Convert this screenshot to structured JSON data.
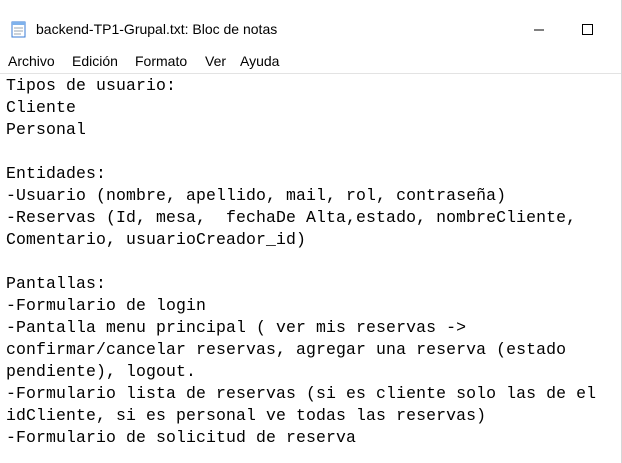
{
  "window": {
    "title": "backend-TP1-Grupal.txt: Bloc de notas",
    "icon": "notepad-icon"
  },
  "menu": [
    {
      "label": "Archivo"
    },
    {
      "label": "Edición"
    },
    {
      "label": "Formato"
    },
    {
      "label": "Ver"
    },
    {
      "label": "Ayuda"
    }
  ],
  "editor": {
    "lines": [
      "Tipos de usuario:",
      "Cliente",
      "Personal",
      "",
      "Entidades:",
      "-Usuario (nombre, apellido, mail, rol, contraseña)",
      "-Reservas (Id, mesa,  fechaDe Alta,estado, nombreCliente,",
      "Comentario, usuarioCreador_id)",
      "",
      "Pantallas:",
      "-Formulario de login",
      "-Pantalla menu principal ( ver mis reservas ->",
      "confirmar/cancelar reservas, agregar una reserva (estado",
      "pendiente), logout.",
      "-Formulario lista de reservas (si es cliente solo las de el",
      "idCliente, si es personal ve todas las reservas)",
      "-Formulario de solicitud de reserva"
    ]
  }
}
